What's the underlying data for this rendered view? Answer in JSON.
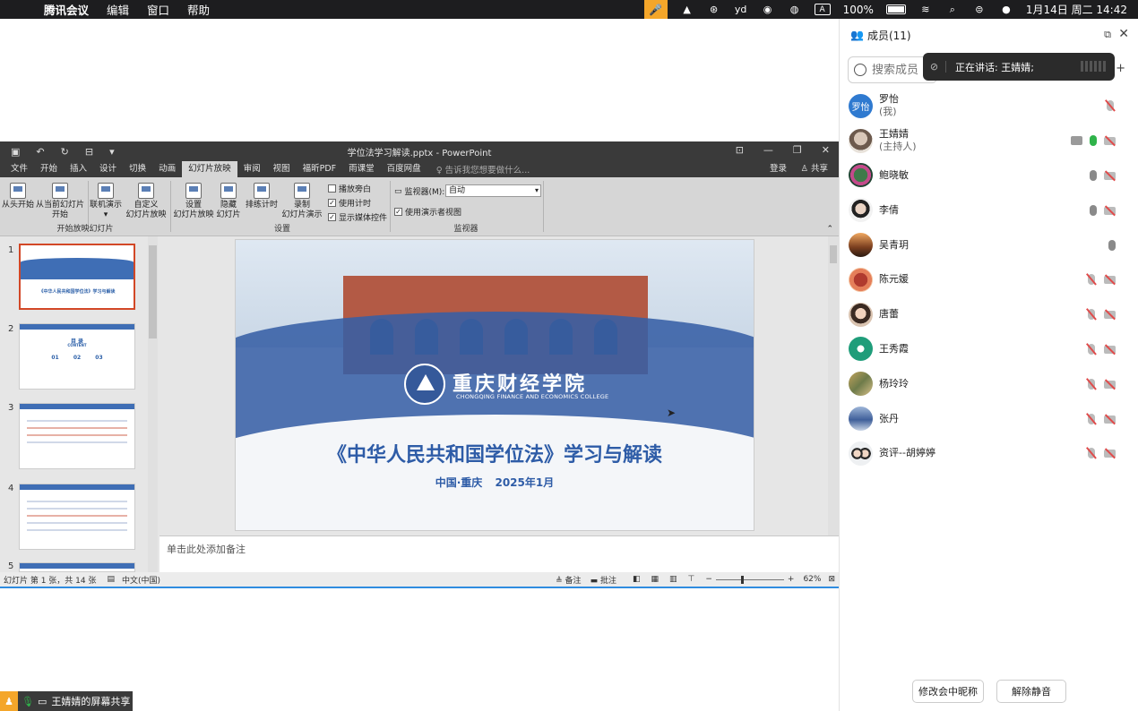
{
  "menubar": {
    "app": "腾讯会议",
    "menus": [
      "编辑",
      "窗口",
      "帮助"
    ],
    "battery": "100%",
    "datetime": "1月14日 周二  14:42",
    "input_method": "A"
  },
  "ppt": {
    "window_title": "学位法学习解读.pptx - PowerPoint",
    "tabs": [
      "文件",
      "开始",
      "插入",
      "设计",
      "切换",
      "动画",
      "幻灯片放映",
      "审阅",
      "视图",
      "福昕PDF",
      "雨课堂",
      "百度网盘"
    ],
    "active_tab": "幻灯片放映",
    "tell_me": "告诉我您想要做什么...",
    "login": "登录",
    "share": "共享",
    "ribbon": {
      "from_start": "从头开始",
      "from_current_1": "从当前幻灯片",
      "from_current_2": "开始",
      "online_1": "联机演示",
      "custom_1": "自定义",
      "custom_2": "幻灯片放映",
      "group_start": "开始放映幻灯片",
      "setup_1": "设置",
      "setup_2": "幻灯片放映",
      "hide_1": "隐藏",
      "hide_2": "幻灯片",
      "rehearse": "排练计时",
      "record_1": "录制",
      "record_2": "幻灯片演示",
      "play_narration": "播放旁白",
      "use_timings": "使用计时",
      "show_media": "显示媒体控件",
      "group_setup": "设置",
      "monitor_label": "监视器(M):",
      "monitor_value": "自动",
      "presenter_view": "使用演示者视图",
      "group_monitor": "监视器"
    },
    "thumbnails": [
      {
        "num": "1",
        "title": "《中华人民共和国学位法》学习与解读"
      },
      {
        "num": "2",
        "title": "目 录",
        "sub": "CONTENT",
        "items": [
          "01",
          "02",
          "03"
        ]
      },
      {
        "num": "3",
        "title": ""
      },
      {
        "num": "4",
        "title": ""
      },
      {
        "num": "5",
        "title": ""
      }
    ],
    "slide": {
      "school_cn": "重庆财经学院",
      "school_en": "CHONGQING FINANCE AND ECONOMICS COLLEGE",
      "title": "《中华人民共和国学位法》学习与解读",
      "subtitle": "中国·重庆    2025年1月"
    },
    "notes_placeholder": "单击此处添加备注",
    "status": {
      "slide_info": "幻灯片 第 1 张，共 14 张",
      "language": "中文(中国)",
      "notes": "备注",
      "comments": "批注",
      "zoom": "62%"
    }
  },
  "share_badge": "王婧婧的屏幕共享",
  "panel": {
    "title": "成员(11)",
    "search_placeholder": "搜索成员",
    "speaking": "正在讲话:   王婧婧;",
    "members": [
      {
        "name": "罗怡",
        "sub": "(我)",
        "avatar_text": "罗怡",
        "mic": "off",
        "cam": "none",
        "screen": false
      },
      {
        "name": "王婧婧",
        "sub": "(主持人)",
        "mic": "green",
        "cam": "off",
        "screen": true
      },
      {
        "name": "鲍晓敏",
        "mic": "on",
        "cam": "off",
        "screen": false
      },
      {
        "name": "李倩",
        "mic": "on",
        "cam": "off",
        "screen": false
      },
      {
        "name": "吴青玥",
        "mic": "on",
        "cam": "none",
        "screen": false
      },
      {
        "name": "陈元媛",
        "mic": "off",
        "cam": "off",
        "screen": false
      },
      {
        "name": "唐蕾",
        "mic": "off",
        "cam": "off",
        "screen": false
      },
      {
        "name": "王秀霞",
        "mic": "off",
        "cam": "off",
        "screen": false
      },
      {
        "name": "杨玲玲",
        "mic": "off",
        "cam": "off",
        "screen": false
      },
      {
        "name": "张丹",
        "mic": "off",
        "cam": "off",
        "screen": false
      },
      {
        "name": "资评--胡婷婷",
        "mic": "off",
        "cam": "off",
        "screen": false
      }
    ],
    "rename_button": "修改会中昵称",
    "unmute_button": "解除静音"
  },
  "colors": {
    "accent_orange": "#f4a62a",
    "slide_blue": "#2e5ca7",
    "mute_red": "#e04b4b",
    "talk_green": "#2fb34a"
  }
}
